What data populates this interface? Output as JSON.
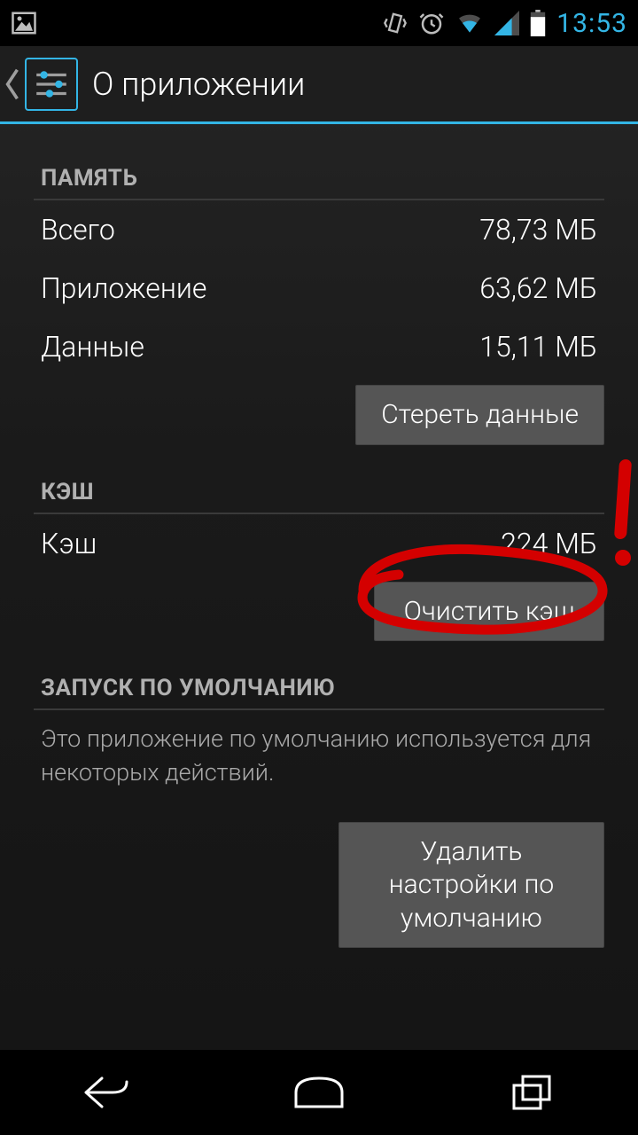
{
  "status": {
    "time": "13:53"
  },
  "header": {
    "title": "О приложении"
  },
  "memory": {
    "header": "ПАМЯТЬ",
    "rows": [
      {
        "label": "Всего",
        "value": "78,73 МБ"
      },
      {
        "label": "Приложение",
        "value": "63,62 МБ"
      },
      {
        "label": "Данные",
        "value": "15,11 МБ"
      }
    ],
    "clear_button": "Стереть данные"
  },
  "cache": {
    "header": "КЭШ",
    "row": {
      "label": "Кэш",
      "value": "224 МБ"
    },
    "clear_button": "Очистить кэш"
  },
  "launch": {
    "header": "ЗАПУСК ПО УМОЛЧАНИЮ",
    "description": "Это приложение по умолчанию используется для некоторых действий.",
    "clear_button": "Удалить настройки по умолчанию"
  }
}
